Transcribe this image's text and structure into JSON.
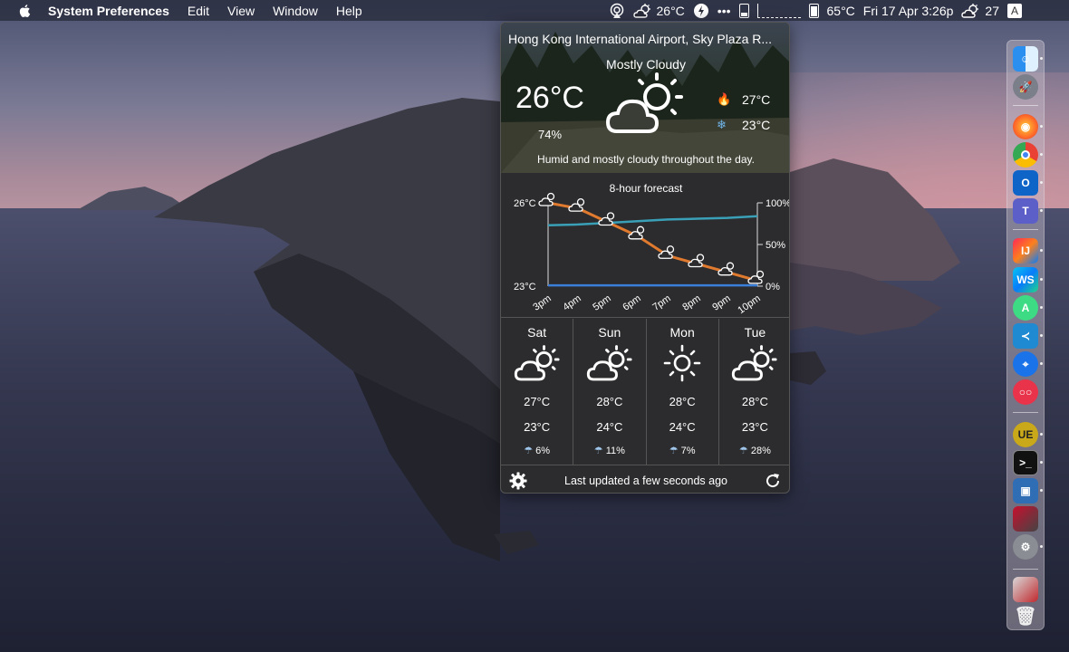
{
  "menubar": {
    "app_name": "System Preferences",
    "menus": [
      "Edit",
      "View",
      "Window",
      "Help"
    ]
  },
  "status": {
    "weather_temp": "26°C",
    "cpu_temp": "65°C",
    "datetime": "Fri 17 Apr 3:26p",
    "second_weather": "27",
    "input_source": "A",
    "more": "•••"
  },
  "weather": {
    "location": "Hong Kong International Airport, Sky Plaza R...",
    "condition": "Mostly Cloudy",
    "temperature": "26°C",
    "humidity": "74%",
    "high": "27°C",
    "low": "23°C",
    "summary": "Humid and mostly cloudy throughout the day.",
    "last_updated": "Last updated a few seconds ago",
    "icon": "partly-cloudy-icon"
  },
  "forecast_chart": {
    "title": "8-hour forecast",
    "left_top": "26°C",
    "left_bottom": "23°C",
    "right_top": "100%",
    "right_mid": "50%",
    "right_bottom": "0%"
  },
  "chart_data": {
    "type": "line",
    "title": "8-hour forecast",
    "categories": [
      "3pm",
      "4pm",
      "5pm",
      "6pm",
      "7pm",
      "8pm",
      "9pm",
      "10pm"
    ],
    "series": [
      {
        "name": "temperature",
        "unit": "°C",
        "values": [
          26,
          25.8,
          25.3,
          24.8,
          24.1,
          23.8,
          23.5,
          23.2
        ],
        "color": "#e07a2e"
      },
      {
        "name": "humidity",
        "unit": "%",
        "values": [
          73,
          74,
          76,
          78,
          80,
          81,
          82,
          84
        ],
        "color": "#3aa0b8"
      },
      {
        "name": "precipitation",
        "unit": "%",
        "values": [
          1,
          1,
          1,
          1,
          1,
          1,
          1,
          1
        ],
        "color": "#3a7fd8"
      }
    ],
    "ylim_left": [
      23,
      26
    ],
    "ylim_right": [
      0,
      100
    ]
  },
  "daily": [
    {
      "day": "Sat",
      "high": "27°C",
      "low": "23°C",
      "precip": "6%",
      "icon": "partly-cloudy-icon"
    },
    {
      "day": "Sun",
      "high": "28°C",
      "low": "24°C",
      "precip": "11%",
      "icon": "partly-cloudy-icon"
    },
    {
      "day": "Mon",
      "high": "28°C",
      "low": "24°C",
      "precip": "7%",
      "icon": "sun-icon"
    },
    {
      "day": "Tue",
      "high": "28°C",
      "low": "23°C",
      "precip": "28%",
      "icon": "partly-cloudy-icon"
    }
  ],
  "dock_apps": [
    "Finder",
    "Launchpad",
    "Firefox",
    "Chrome",
    "Outlook",
    "Teams",
    "IntelliJ IDEA",
    "WebStorm",
    "Android Studio",
    "VS Code",
    "Maps",
    "Flickr",
    "UltraEdit",
    "Terminal",
    "VirtualBox",
    "Screen Capture",
    "System Preferences",
    "Downloads",
    "Trash"
  ]
}
